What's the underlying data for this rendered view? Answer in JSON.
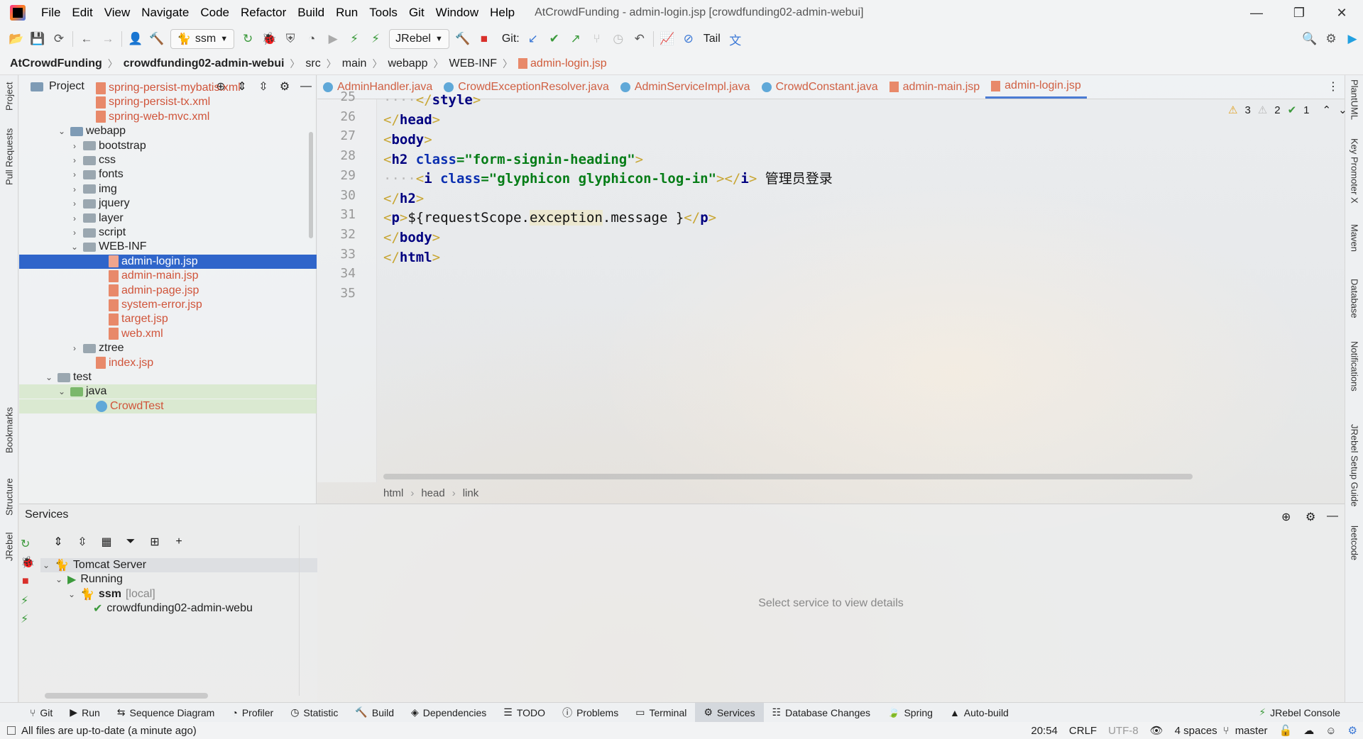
{
  "window": {
    "title": "AtCrowdFunding - admin-login.jsp [crowdfunding02-admin-webui]",
    "controls": {
      "minimize": "—",
      "restore": "❐",
      "close": "✕"
    }
  },
  "menu": [
    "File",
    "Edit",
    "View",
    "Navigate",
    "Code",
    "Refactor",
    "Build",
    "Run",
    "Tools",
    "Git",
    "Window",
    "Help"
  ],
  "toolbar": {
    "run_config": "ssm",
    "jrebel": "JRebel",
    "git_label": "Git:",
    "tail_label": "Tail"
  },
  "breadcrumbs": [
    "AtCrowdFunding",
    "crowdfunding02-admin-webui",
    "src",
    "main",
    "webapp",
    "WEB-INF",
    "admin-login.jsp"
  ],
  "left_strip": [
    "Project",
    "Pull Requests",
    "Bookmarks",
    "Structure",
    "JRebel"
  ],
  "right_strip": [
    "PlantUML",
    "Key Promoter X",
    "Maven",
    "Database",
    "Notifications",
    "JRebel Setup Guide",
    "leetcode"
  ],
  "project_panel": {
    "title": "Project",
    "tree": [
      {
        "label": "spring-persist-mybatis.xml",
        "type": "xml",
        "indent": 6,
        "red": true
      },
      {
        "label": "spring-persist-tx.xml",
        "type": "xml",
        "indent": 6,
        "red": true
      },
      {
        "label": "spring-web-mvc.xml",
        "type": "xml",
        "indent": 6,
        "red": true
      },
      {
        "label": "webapp",
        "type": "webfolder",
        "indent": 4,
        "chev": "v"
      },
      {
        "label": "bootstrap",
        "type": "folder",
        "indent": 5,
        "chev": ">"
      },
      {
        "label": "css",
        "type": "folder",
        "indent": 5,
        "chev": ">"
      },
      {
        "label": "fonts",
        "type": "folder",
        "indent": 5,
        "chev": ">"
      },
      {
        "label": "img",
        "type": "folder",
        "indent": 5,
        "chev": ">"
      },
      {
        "label": "jquery",
        "type": "folder",
        "indent": 5,
        "chev": ">"
      },
      {
        "label": "layer",
        "type": "folder",
        "indent": 5,
        "chev": ">"
      },
      {
        "label": "script",
        "type": "folder",
        "indent": 5,
        "chev": ">"
      },
      {
        "label": "WEB-INF",
        "type": "folder",
        "indent": 5,
        "chev": "v"
      },
      {
        "label": "admin-login.jsp",
        "type": "jsp",
        "indent": 7,
        "selected": true
      },
      {
        "label": "admin-main.jsp",
        "type": "jsp",
        "indent": 7,
        "red": true
      },
      {
        "label": "admin-page.jsp",
        "type": "jsp",
        "indent": 7,
        "red": true
      },
      {
        "label": "system-error.jsp",
        "type": "jsp",
        "indent": 7,
        "red": true
      },
      {
        "label": "target.jsp",
        "type": "jsp",
        "indent": 7,
        "red": true
      },
      {
        "label": "web.xml",
        "type": "xml",
        "indent": 7,
        "red": true
      },
      {
        "label": "ztree",
        "type": "folder",
        "indent": 5,
        "chev": ">"
      },
      {
        "label": "index.jsp",
        "type": "jsp",
        "indent": 6,
        "red": true
      },
      {
        "label": "test",
        "type": "folder",
        "indent": 3,
        "chev": "v"
      },
      {
        "label": "java",
        "type": "testfolder",
        "indent": 4,
        "chev": "v",
        "green": true
      },
      {
        "label": "CrowdTest",
        "type": "class",
        "indent": 6,
        "red": true,
        "green": true
      }
    ]
  },
  "editor": {
    "tabs": [
      {
        "label": "AdminHandler.java",
        "kind": "class"
      },
      {
        "label": "CrowdExceptionResolver.java",
        "kind": "class"
      },
      {
        "label": "AdminServiceImpl.java",
        "kind": "class"
      },
      {
        "label": "CrowdConstant.java",
        "kind": "class"
      },
      {
        "label": "admin-main.jsp",
        "kind": "jsp"
      },
      {
        "label": "admin-login.jsp",
        "kind": "jsp",
        "active": true
      }
    ],
    "line_numbers": [
      "25",
      "26",
      "27",
      "28",
      "29",
      "30",
      "31",
      "32",
      "33",
      "34",
      "35"
    ],
    "inspections": {
      "warnings": "3",
      "weak_warnings": "2",
      "ok": "1"
    },
    "crumbs": [
      "html",
      "head",
      "link"
    ]
  },
  "services": {
    "title": "Services",
    "detail_placeholder": "Select service to view details",
    "tree": [
      {
        "label": "Tomcat Server",
        "indent": 0,
        "chev": "v"
      },
      {
        "label": "Running",
        "indent": 1,
        "chev": "v"
      },
      {
        "label": "ssm",
        "suffix": "[local]",
        "indent": 2,
        "chev": "v"
      },
      {
        "label": "crowdfunding02-admin-webu",
        "indent": 3
      }
    ]
  },
  "bottom_tabs": [
    {
      "label": "Git",
      "icon": "git-icon"
    },
    {
      "label": "Run",
      "icon": "run-icon"
    },
    {
      "label": "Sequence Diagram",
      "icon": "sequence-diagram-icon"
    },
    {
      "label": "Profiler",
      "icon": "profiler-icon"
    },
    {
      "label": "Statistic",
      "icon": "statistic-icon"
    },
    {
      "label": "Build",
      "icon": "build-icon"
    },
    {
      "label": "Dependencies",
      "icon": "dependencies-icon"
    },
    {
      "label": "TODO",
      "icon": "todo-icon"
    },
    {
      "label": "Problems",
      "icon": "problems-icon"
    },
    {
      "label": "Terminal",
      "icon": "terminal-icon"
    },
    {
      "label": "Services",
      "icon": "services-icon",
      "active": true
    },
    {
      "label": "Database Changes",
      "icon": "database-changes-icon"
    },
    {
      "label": "Spring",
      "icon": "spring-icon"
    },
    {
      "label": "Auto-build",
      "icon": "auto-build-icon"
    }
  ],
  "jrebel_console": "JRebel Console",
  "status": {
    "message": "All files are up-to-date (a minute ago)",
    "position": "20:54",
    "line_sep": "CRLF",
    "encoding": "UTF-8",
    "indent": "4 spaces",
    "branch": "master"
  }
}
